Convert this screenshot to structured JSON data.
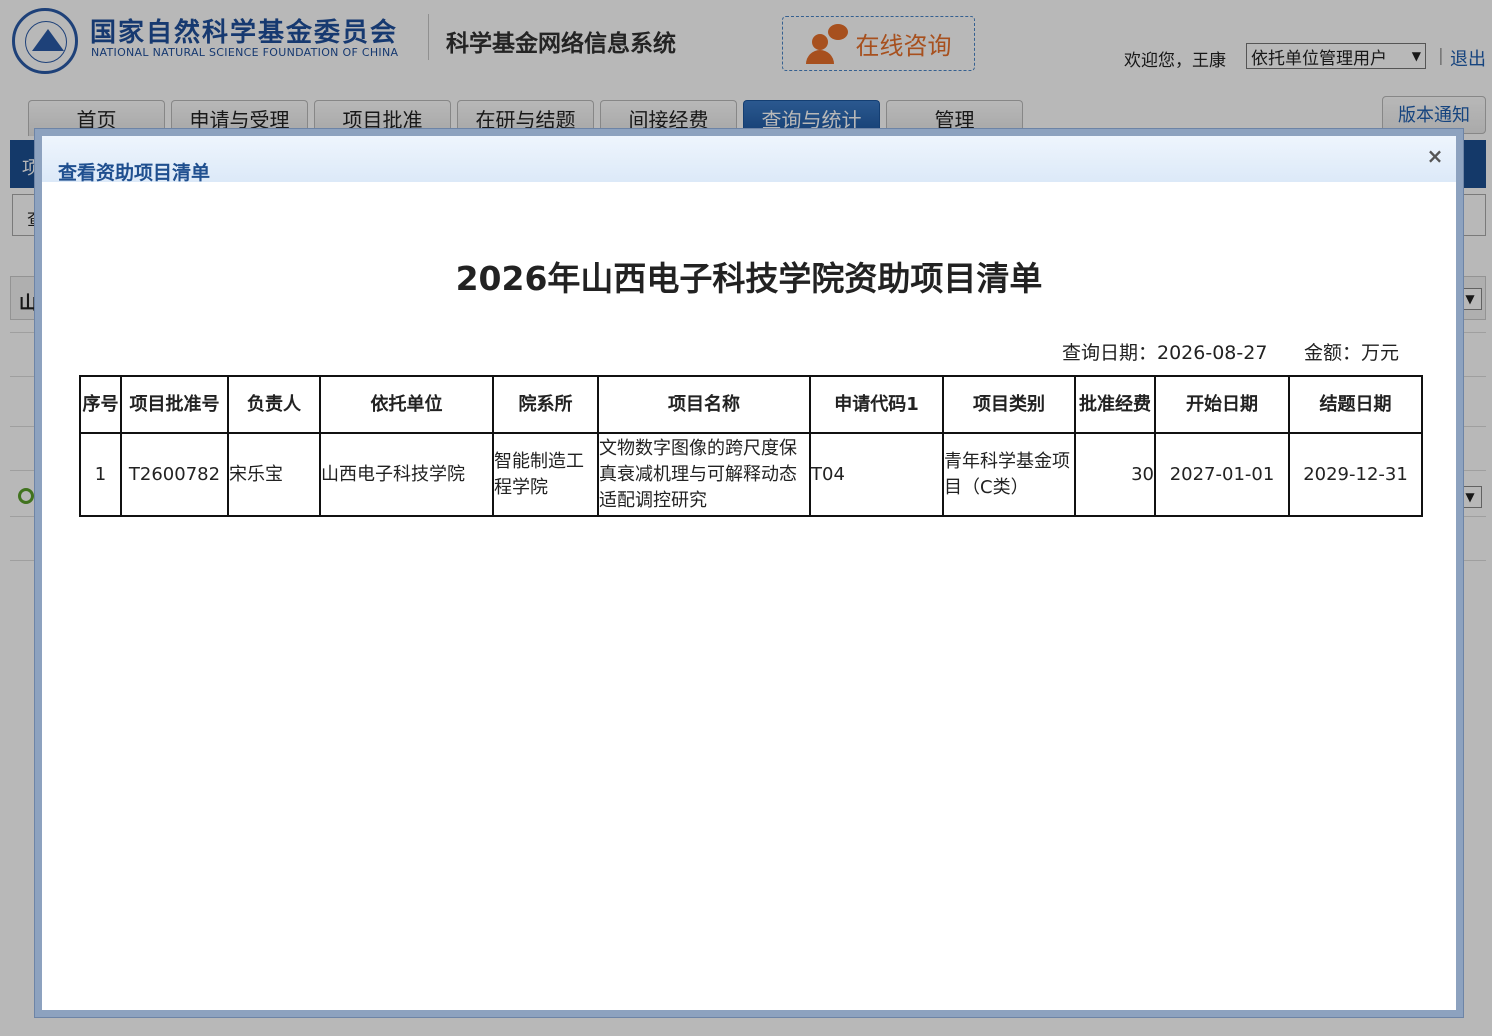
{
  "header": {
    "org_name_cn": "国家自然科学基金委员会",
    "org_name_en": "NATIONAL NATURAL SCIENCE FOUNDATION OF CHINA",
    "system_name": "科学基金网络信息系统",
    "consult_label": "在线咨询",
    "welcome": "欢迎您，王康",
    "role_selected": "依托单位管理用户",
    "logout": "退出"
  },
  "nav": {
    "tabs": [
      "首页",
      "申请与受理",
      "项目批准",
      "在研与结题",
      "间接经费",
      "查询与统计",
      "管理"
    ],
    "active_index": 5,
    "version_notice": "版本通知"
  },
  "background_fragments": {
    "blue_bar": "项",
    "filter": "查",
    "section": "山"
  },
  "modal": {
    "title": "查看资助项目清单",
    "close": "×",
    "report_title": "2026年山西电子科技学院资助项目清单",
    "query_date": "查询日期：2026-08-27",
    "amount_unit": "金额：万元",
    "columns": [
      "序号",
      "项目批准号",
      "负责人",
      "依托单位",
      "院系所",
      "项目名称",
      "申请代码1",
      "项目类别",
      "批准经费",
      "开始日期",
      "结题日期"
    ],
    "rows": [
      {
        "index": "1",
        "approval_no": "T2600782",
        "leader": "宋乐宝",
        "institution": "山西电子科技学院",
        "department": "智能制造工程学院",
        "project_name": "文物数字图像的跨尺度保真衰减机理与可解释动态适配调控研究",
        "code": "T04",
        "category": "青年科学基金项目（C类）",
        "funding": "30",
        "start_date": "2027-01-01",
        "end_date": "2029-12-31"
      }
    ]
  },
  "colors": {
    "brand_blue": "#1f4f9c",
    "consult_orange": "#e8702a",
    "active_tab": "#1c569f",
    "modal_frame": "#8da2bf"
  }
}
